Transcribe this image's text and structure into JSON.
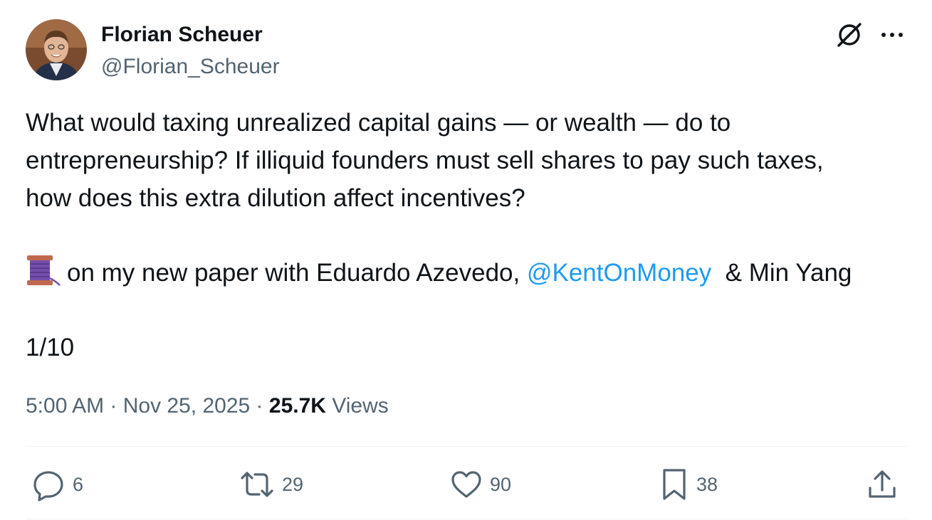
{
  "author": {
    "display_name": "Florian Scheuer",
    "handle": "@Florian_Scheuer",
    "avatar_icon": "profile-photo"
  },
  "header_icons": {
    "grok": "grok-icon",
    "more": "more-options-icon"
  },
  "tweet": {
    "line1": "What would taxing unrealized capital gains — or wealth — do to",
    "line2": "entrepreneurship? If illiquid founders must sell shares to pay such taxes,",
    "line3": "how does this extra dilution affect incentives?",
    "thread_emoji": "thread-spool-icon",
    "line4_text": "on my new paper with Eduardo Azevedo, ",
    "mention": "@KentOnMoney",
    "line4_tail": "  & Min Yang",
    "thread_counter": "1/10"
  },
  "meta": {
    "time": "5:00 AM",
    "separator": " · ",
    "date": "Nov 25, 2025",
    "views_count": "25.7K",
    "views_label": " Views"
  },
  "actions": {
    "replies": "6",
    "reposts": "29",
    "likes": "90",
    "bookmarks": "38"
  },
  "colors": {
    "text": "#0f1419",
    "secondary": "#536471",
    "link": "#1d9bf0",
    "divider": "#eff3f4"
  }
}
